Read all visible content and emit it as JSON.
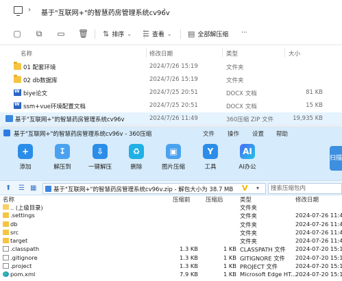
{
  "explorer": {
    "breadcrumb_chevron": "›",
    "path": "基于\"互联网+\"的智慧药房管理系统cv96v",
    "path_chevron": "›",
    "toolbar": {
      "icons": [
        "new-folder-icon",
        "copy-icon",
        "rename-icon",
        "share-icon",
        "delete-icon"
      ],
      "sort_label": "排序",
      "view_label": "查看",
      "extract_all_label": "全部解压缩",
      "more_label": "···"
    },
    "columns": {
      "name": "名称",
      "date": "修改日期",
      "type": "类型",
      "size": "大小"
    },
    "rows": [
      {
        "icon": "folder",
        "name": "01 配套环境",
        "date": "2024/7/26 15:19",
        "type": "文件夹",
        "size": ""
      },
      {
        "icon": "folder",
        "name": "02 db数据库",
        "date": "2024/7/26 15:19",
        "type": "文件夹",
        "size": ""
      },
      {
        "icon": "doc",
        "name": "biye论文",
        "date": "2024/7/25 20:51",
        "type": "DOCX 文档",
        "size": "81 KB"
      },
      {
        "icon": "doc",
        "name": "ssm+vue环境配置文档",
        "date": "2024/7/25 20:51",
        "type": "DOCX 文档",
        "size": "15 KB"
      },
      {
        "icon": "zip",
        "name": "基于\"互联网+\"的智慧药房管理系统cv96v",
        "date": "2024/7/26 11:49",
        "type": "360压缩 ZIP 文件",
        "size": "19,935 KB"
      }
    ]
  },
  "zip": {
    "title": "基于\"互联网+\"的智慧药房管理系统cv96v - 360压缩",
    "menu": [
      "文件",
      "操作",
      "设置",
      "帮助"
    ],
    "tools": [
      {
        "label": "添加",
        "glyph": "+"
      },
      {
        "label": "解压到",
        "glyph": "↧"
      },
      {
        "label": "一键解压",
        "glyph": "⇩"
      },
      {
        "label": "删除",
        "glyph": "♻"
      },
      {
        "label": "图片压缩",
        "glyph": "▣"
      },
      {
        "label": "工具",
        "glyph": "Y"
      },
      {
        "label": "AI办公",
        "glyph": "AI"
      }
    ],
    "side_badge": "扫描",
    "address": "基于\"互联网+\"的智慧药房管理系统cv96v.zip - 解包大小为 38.7 MB",
    "search_placeholder": "搜索压缩包内",
    "columns": {
      "name": "名称",
      "size": "压缩前",
      "csize": "压缩后",
      "type": "类型",
      "date": "修改日期"
    },
    "rows": [
      {
        "icon": "up",
        "name": ".. (上级目录)",
        "size": "",
        "csize": "",
        "type": "文件夹",
        "date": ""
      },
      {
        "icon": "folder",
        "name": ".settings",
        "size": "",
        "csize": "",
        "type": "文件夹",
        "date": "2024-07-26 11:49"
      },
      {
        "icon": "folder",
        "name": "db",
        "size": "",
        "csize": "",
        "type": "文件夹",
        "date": "2024-07-26 11:49"
      },
      {
        "icon": "folder",
        "name": "src",
        "size": "",
        "csize": "",
        "type": "文件夹",
        "date": "2024-07-26 11:49"
      },
      {
        "icon": "folder",
        "name": "target",
        "size": "",
        "csize": "",
        "type": "文件夹",
        "date": "2024-07-26 11:49"
      },
      {
        "icon": "file",
        "name": ".classpath",
        "size": "1.3 KB",
        "csize": "1 KB",
        "type": "CLASSPATH 文件",
        "date": "2024-07-20 15:11"
      },
      {
        "icon": "file",
        "name": ".gitignore",
        "size": "1.3 KB",
        "csize": "1 KB",
        "type": "GITIGNORE 文件",
        "date": "2024-07-20 15:11"
      },
      {
        "icon": "file",
        "name": ".project",
        "size": "1.3 KB",
        "csize": "1 KB",
        "type": "PROJECT 文件",
        "date": "2024-07-20 15:11"
      },
      {
        "icon": "edge",
        "name": "pom.xml",
        "size": "7.9 KB",
        "csize": "1 KB",
        "type": "Microsoft Edge HT...",
        "date": "2024-07-20 15:11"
      }
    ]
  }
}
